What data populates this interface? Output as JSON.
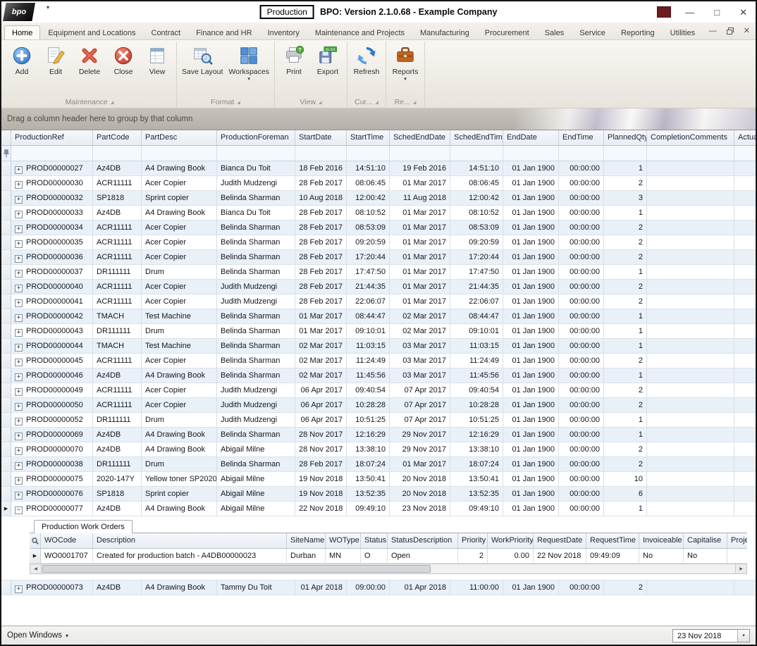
{
  "icons": {
    "logo_dropdown": "▾",
    "titlebar_minimize": "—",
    "titlebar_maximize": "□",
    "titlebar_close": "✕",
    "ribbon_minimize": "—",
    "ribbon_close": "✕",
    "dropdown": "▾",
    "launcher": "◢",
    "expand": "+",
    "collapse": "−",
    "row_arrow": "▶",
    "scroll_left": "◀",
    "scroll_right": "▶"
  },
  "window": {
    "logo_text": "bpo",
    "module_badge": "Production",
    "title": "BPO: Version 2.1.0.68 - Example Company"
  },
  "active_tab": "Home",
  "ribbon_tabs": [
    "Home",
    "Equipment and Locations",
    "Contract",
    "Finance and HR",
    "Inventory",
    "Maintenance and Projects",
    "Manufacturing",
    "Procurement",
    "Sales",
    "Service",
    "Reporting",
    "Utilities"
  ],
  "ribbon": {
    "groups": [
      {
        "label": "Maintenance",
        "buttons": [
          {
            "label": "Add",
            "icon": "add-icon"
          },
          {
            "label": "Edit",
            "icon": "edit-icon"
          },
          {
            "label": "Delete",
            "icon": "delete-icon"
          },
          {
            "label": "Close",
            "icon": "close-icon"
          },
          {
            "label": "View",
            "icon": "view-icon"
          }
        ]
      },
      {
        "label": "Format",
        "buttons": [
          {
            "label": "Save Layout",
            "icon": "save-layout-icon"
          },
          {
            "label": "Workspaces",
            "icon": "workspaces-icon",
            "dropdown": true
          }
        ]
      },
      {
        "label": "View",
        "buttons": [
          {
            "label": "Print",
            "icon": "print-icon"
          },
          {
            "label": "Export",
            "icon": "export-icon"
          }
        ]
      },
      {
        "label": "Cur...",
        "buttons": [
          {
            "label": "Refresh",
            "icon": "refresh-icon"
          }
        ]
      },
      {
        "label": "Re...",
        "buttons": [
          {
            "label": "Reports",
            "icon": "reports-icon",
            "dropdown": true
          }
        ]
      }
    ]
  },
  "grid": {
    "group_by_hint": "Drag a column header here to group by that column",
    "columns": [
      "ProductionRef",
      "PartCode",
      "PartDesc",
      "ProductionForeman",
      "StartDate",
      "StartTime",
      "SchedEndDate",
      "SchedEndTime",
      "EndDate",
      "EndTime",
      "PlannedQty",
      "CompletionComments",
      "Actual"
    ],
    "expanded_ref": "PROD00000077",
    "rows": [
      [
        "PROD00000027",
        "Az4DB",
        "A4 Drawing Book",
        "Bianca Du Toit",
        "18 Feb 2016",
        "14:51:10",
        "19 Feb 2016",
        "14:51:10",
        "01 Jan 1900",
        "00:00:00",
        "1"
      ],
      [
        "PROD00000030",
        "ACR11111",
        "Acer Copier",
        "Judith Mudzengi",
        "28 Feb 2017",
        "08:06:45",
        "01 Mar 2017",
        "08:06:45",
        "01 Jan 1900",
        "00:00:00",
        "2"
      ],
      [
        "PROD00000032",
        "SP1818",
        "Sprint copier",
        "Belinda Sharman",
        "10 Aug 2018",
        "12:00:42",
        "11 Aug 2018",
        "12:00:42",
        "01 Jan 1900",
        "00:00:00",
        "3"
      ],
      [
        "PROD00000033",
        "Az4DB",
        "A4 Drawing Book",
        "Bianca Du Toit",
        "28 Feb 2017",
        "08:10:52",
        "01 Mar 2017",
        "08:10:52",
        "01 Jan 1900",
        "00:00:00",
        "1"
      ],
      [
        "PROD00000034",
        "ACR11111",
        "Acer Copier",
        "Belinda Sharman",
        "28 Feb 2017",
        "08:53:09",
        "01 Mar 2017",
        "08:53:09",
        "01 Jan 1900",
        "00:00:00",
        "2"
      ],
      [
        "PROD00000035",
        "ACR11111",
        "Acer Copier",
        "Belinda Sharman",
        "28 Feb 2017",
        "09:20:59",
        "01 Mar 2017",
        "09:20:59",
        "01 Jan 1900",
        "00:00:00",
        "2"
      ],
      [
        "PROD00000036",
        "ACR11111",
        "Acer Copier",
        "Belinda Sharman",
        "28 Feb 2017",
        "17:20:44",
        "01 Mar 2017",
        "17:20:44",
        "01 Jan 1900",
        "00:00:00",
        "2"
      ],
      [
        "PROD00000037",
        "DR111111",
        "Drum",
        "Belinda Sharman",
        "28 Feb 2017",
        "17:47:50",
        "01 Mar 2017",
        "17:47:50",
        "01 Jan 1900",
        "00:00:00",
        "1"
      ],
      [
        "PROD00000040",
        "ACR11111",
        "Acer Copier",
        "Judith Mudzengi",
        "28 Feb 2017",
        "21:44:35",
        "01 Mar 2017",
        "21:44:35",
        "01 Jan 1900",
        "00:00:00",
        "2"
      ],
      [
        "PROD00000041",
        "ACR11111",
        "Acer Copier",
        "Judith Mudzengi",
        "28 Feb 2017",
        "22:06:07",
        "01 Mar 2017",
        "22:06:07",
        "01 Jan 1900",
        "00:00:00",
        "2"
      ],
      [
        "PROD00000042",
        "TMACH",
        "Test Machine",
        "Belinda Sharman",
        "01 Mar 2017",
        "08:44:47",
        "02 Mar 2017",
        "08:44:47",
        "01 Jan 1900",
        "00:00:00",
        "1"
      ],
      [
        "PROD00000043",
        "DR111111",
        "Drum",
        "Belinda Sharman",
        "01 Mar 2017",
        "09:10:01",
        "02 Mar 2017",
        "09:10:01",
        "01 Jan 1900",
        "00:00:00",
        "1"
      ],
      [
        "PROD00000044",
        "TMACH",
        "Test Machine",
        "Belinda Sharman",
        "02 Mar 2017",
        "11:03:15",
        "03 Mar 2017",
        "11:03:15",
        "01 Jan 1900",
        "00:00:00",
        "1"
      ],
      [
        "PROD00000045",
        "ACR11111",
        "Acer Copier",
        "Belinda Sharman",
        "02 Mar 2017",
        "11:24:49",
        "03 Mar 2017",
        "11:24:49",
        "01 Jan 1900",
        "00:00:00",
        "2"
      ],
      [
        "PROD00000046",
        "Az4DB",
        "A4 Drawing Book",
        "Belinda Sharman",
        "02 Mar 2017",
        "11:45:56",
        "03 Mar 2017",
        "11:45:56",
        "01 Jan 1900",
        "00:00:00",
        "1"
      ],
      [
        "PROD00000049",
        "ACR11111",
        "Acer Copier",
        "Judith Mudzengi",
        "06 Apr 2017",
        "09:40:54",
        "07 Apr 2017",
        "09:40:54",
        "01 Jan 1900",
        "00:00:00",
        "2"
      ],
      [
        "PROD00000050",
        "ACR11111",
        "Acer Copier",
        "Judith Mudzengi",
        "06 Apr 2017",
        "10:28:28",
        "07 Apr 2017",
        "10:28:28",
        "01 Jan 1900",
        "00:00:00",
        "2"
      ],
      [
        "PROD00000052",
        "DR111111",
        "Drum",
        "Judith Mudzengi",
        "06 Apr 2017",
        "10:51:25",
        "07 Apr 2017",
        "10:51:25",
        "01 Jan 1900",
        "00:00:00",
        "1"
      ],
      [
        "PROD00000069",
        "Az4DB",
        "A4 Drawing Book",
        "Belinda Sharman",
        "28 Nov 2017",
        "12:16:29",
        "29 Nov 2017",
        "12:16:29",
        "01 Jan 1900",
        "00:00:00",
        "1"
      ],
      [
        "PROD00000070",
        "Az4DB",
        "A4 Drawing Book",
        "Abigail Milne",
        "28 Nov 2017",
        "13:38:10",
        "29 Nov 2017",
        "13:38:10",
        "01 Jan 1900",
        "00:00:00",
        "2"
      ],
      [
        "PROD00000038",
        "DR111111",
        "Drum",
        "Belinda Sharman",
        "28 Feb 2017",
        "18:07:24",
        "01 Mar 2017",
        "18:07:24",
        "01 Jan 1900",
        "00:00:00",
        "2"
      ],
      [
        "PROD00000075",
        "2020-147Y",
        "Yellow toner SP2020",
        "Abigail Milne",
        "19 Nov 2018",
        "13:50:41",
        "20 Nov 2018",
        "13:50:41",
        "01 Jan 1900",
        "00:00:00",
        "10"
      ],
      [
        "PROD00000076",
        "SP1818",
        "Sprint copier",
        "Abigail Milne",
        "19 Nov 2018",
        "13:52:35",
        "20 Nov 2018",
        "13:52:35",
        "01 Jan 1900",
        "00:00:00",
        "6"
      ],
      [
        "PROD00000077",
        "Az4DB",
        "A4 Drawing Book",
        "Abigail Milne",
        "22 Nov 2018",
        "09:49:10",
        "23 Nov 2018",
        "09:49:10",
        "01 Jan 1900",
        "00:00:00",
        "1"
      ]
    ],
    "rows_after_detail": [
      [
        "PROD00000073",
        "Az4DB",
        "A4 Drawing Book",
        "Tammy Du Toit",
        "01 Apr 2018",
        "09:00:00",
        "01 Apr 2018",
        "11:00:00",
        "01 Jan 1900",
        "00:00:00",
        "2"
      ]
    ]
  },
  "detail": {
    "tab_label": "Production Work Orders",
    "columns": [
      "WOCode",
      "Description",
      "SiteName",
      "WOType",
      "Status",
      "StatusDescription",
      "Priority",
      "WorkPriority",
      "RequestDate",
      "RequestTime",
      "Invoiceable",
      "Capitalise",
      "Proje"
    ],
    "rows": [
      [
        "WO0001707",
        "Created for production batch - A4DB00000023",
        "Durban",
        "MN",
        "O",
        "Open",
        "2",
        "0.00",
        "22 Nov 2018",
        "09:49:09",
        "No",
        "No"
      ]
    ]
  },
  "status_bar": {
    "open_windows": "Open Windows",
    "date": "23 Nov 2018"
  }
}
